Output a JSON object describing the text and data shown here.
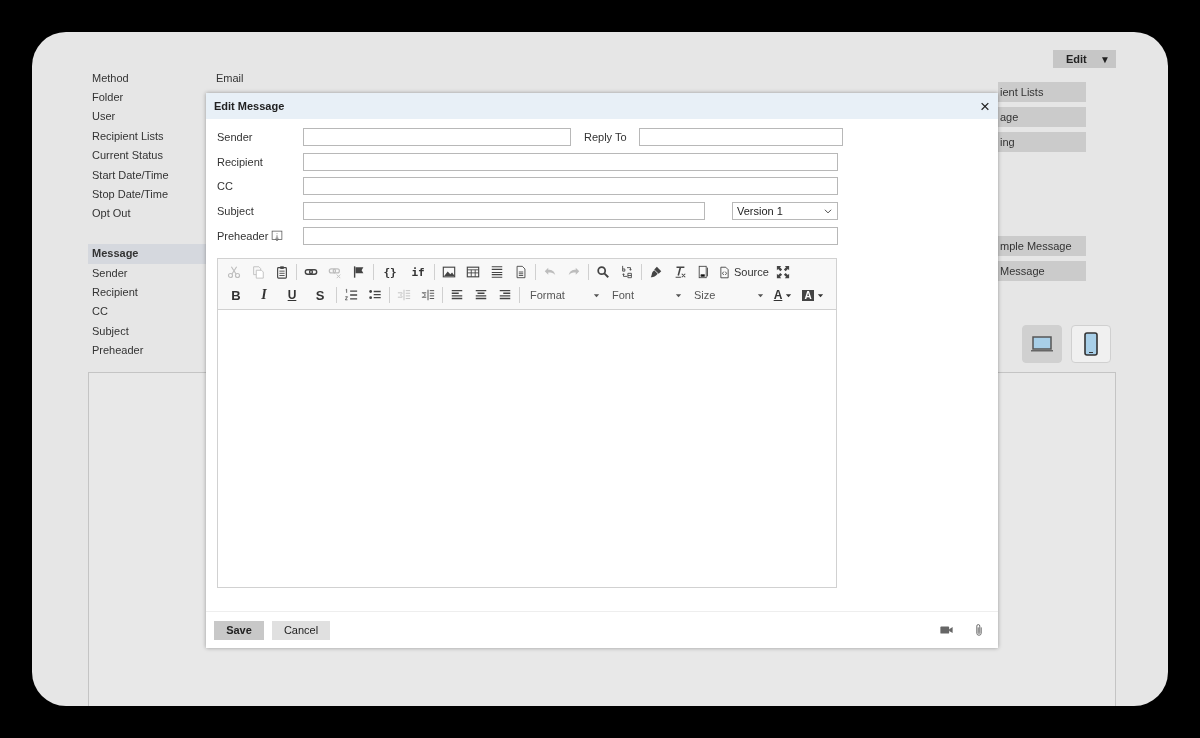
{
  "edit_menu": {
    "label": "Edit",
    "caret": "▼"
  },
  "details": [
    {
      "label": "Method",
      "value": "Email"
    },
    {
      "label": "Folder"
    },
    {
      "label": "User"
    },
    {
      "label": "Recipient Lists"
    },
    {
      "label": "Current Status"
    },
    {
      "label": "Start Date/Time"
    },
    {
      "label": "Stop Date/Time"
    },
    {
      "label": "Opt Out"
    }
  ],
  "message_fields": [
    {
      "label": "Message",
      "kind": "heading"
    },
    {
      "label": "Sender",
      "kind": "item"
    },
    {
      "label": "Recipient",
      "kind": "item"
    },
    {
      "label": "CC",
      "kind": "item"
    },
    {
      "label": "Subject",
      "kind": "item"
    },
    {
      "label": "Preheader",
      "kind": "item"
    }
  ],
  "side_buttons": [
    [
      "ient Lists",
      "age",
      "ing"
    ],
    [
      "mple Message",
      "Message"
    ]
  ],
  "devices": [
    {
      "kind": "laptop",
      "selected": true
    },
    {
      "kind": "phone",
      "selected": false
    }
  ],
  "dialog": {
    "title": "Edit Message",
    "close": "×",
    "fields": [
      {
        "label": "Sender",
        "extra_label": "Reply To"
      },
      {
        "label": "Recipient"
      },
      {
        "label": "CC"
      },
      {
        "label": "Subject",
        "select": "Version 1"
      },
      {
        "label": "Preheader",
        "info": true
      }
    ],
    "toolbar": [
      [
        {
          "kind": "cut",
          "disabled": true
        },
        {
          "kind": "copy",
          "disabled": true
        },
        {
          "kind": "paste",
          "disabled": false
        },
        {
          "kind": "separator"
        },
        {
          "kind": "link",
          "disabled": false
        },
        {
          "kind": "unlink",
          "disabled": true
        },
        {
          "kind": "anchor",
          "disabled": false
        },
        {
          "kind": "separator"
        },
        {
          "kind": "text",
          "label": "{}",
          "disabled": false
        },
        {
          "kind": "text",
          "label": "if",
          "disabled": false
        },
        {
          "kind": "separator"
        },
        {
          "kind": "image",
          "disabled": false
        },
        {
          "kind": "table",
          "disabled": false
        },
        {
          "kind": "rule",
          "disabled": false
        },
        {
          "kind": "template",
          "disabled": false
        },
        {
          "kind": "separator"
        },
        {
          "kind": "undo",
          "disabled": true
        },
        {
          "kind": "redo",
          "disabled": true
        },
        {
          "kind": "separator"
        },
        {
          "kind": "find",
          "disabled": false
        },
        {
          "kind": "replace",
          "disabled": false
        },
        {
          "kind": "separator"
        },
        {
          "kind": "brush",
          "disabled": false
        },
        {
          "kind": "clearformat",
          "disabled": false
        },
        {
          "kind": "blocks",
          "disabled": false
        },
        {
          "kind": "source",
          "label": "Source",
          "disabled": false
        },
        {
          "kind": "maximize",
          "disabled": false
        }
      ],
      [
        {
          "kind": "bold",
          "label": "B",
          "disabled": false
        },
        {
          "kind": "italic",
          "label": "I",
          "disabled": false
        },
        {
          "kind": "underline",
          "label": "U",
          "disabled": false
        },
        {
          "kind": "strike",
          "label": "S",
          "disabled": false
        },
        {
          "kind": "separator"
        },
        {
          "kind": "numbered",
          "disabled": false
        },
        {
          "kind": "bulleted",
          "disabled": false
        },
        {
          "kind": "separator"
        },
        {
          "kind": "outdent",
          "disabled": true
        },
        {
          "kind": "indent",
          "disabled": false
        },
        {
          "kind": "separator"
        },
        {
          "kind": "alignleft",
          "disabled": false
        },
        {
          "kind": "aligncenter",
          "disabled": false
        },
        {
          "kind": "alignright",
          "disabled": false
        },
        {
          "kind": "separator"
        },
        {
          "kind": "combo",
          "label": "Format",
          "disabled": false
        },
        {
          "kind": "combo",
          "label": "Font",
          "disabled": false
        },
        {
          "kind": "combo",
          "label": "Size",
          "disabled": false
        },
        {
          "kind": "textcolor",
          "label": "A",
          "disabled": false
        },
        {
          "kind": "bgcolor",
          "label": "A",
          "disabled": false
        }
      ]
    ],
    "buttons": [
      {
        "label": "Save",
        "kind": "primary"
      },
      {
        "label": "Cancel",
        "kind": "secondary"
      }
    ]
  }
}
